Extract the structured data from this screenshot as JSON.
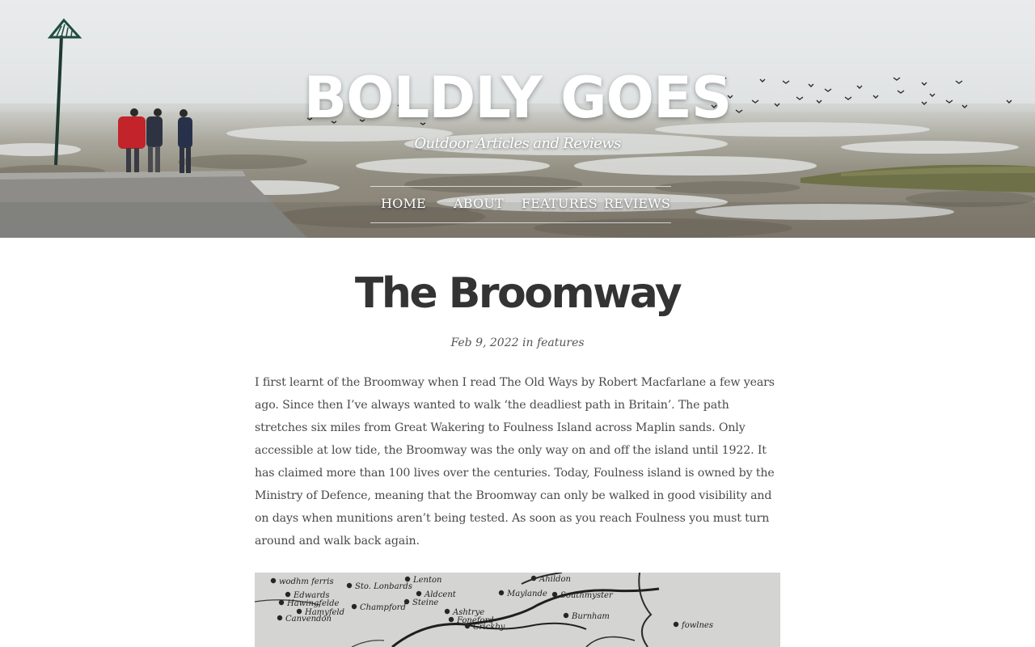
{
  "site": {
    "title": "BOLDLY GOES",
    "tagline": "Outdoor Articles and Reviews"
  },
  "nav": {
    "items": [
      {
        "label": "HOME"
      },
      {
        "label": "ABOUT"
      },
      {
        "label": "FEATURES"
      },
      {
        "label": "REVIEWS"
      }
    ]
  },
  "post": {
    "title": "The Broomway",
    "meta": {
      "date": "Feb 9, 2022",
      "in_word": "in",
      "category": "features"
    },
    "body": "I first learnt of the Broomway when I read The Old Ways by Robert Macfarlane a few years ago. Since then I’ve always wanted to walk ‘the deadliest path in Britain’. The path stretches six miles from Great Wakering to Foulness Island across Maplin sands. Only accessible at low tide, the Broomway was the only way on and off the island until 1922. It has claimed more than 100 lives over the centuries. Today, Foulness island is owned by the Ministry of Defence, meaning that the Broomway can only be walked in good visibility and on days when munitions aren’t being tested. As soon as you reach Foulness you must turn around and walk back again."
  },
  "map_image": {
    "labels": [
      "wodhm ferris",
      "Edwards",
      "Hawingfelde",
      "Hamyfeld",
      "Canvendon",
      "Sto. Lonbards",
      "Lenton",
      "Aldcent",
      "Champford",
      "Steine",
      "Foneford",
      "Ashtrye",
      "Crickby",
      "Ahildon",
      "Maylande",
      "Southmyster",
      "Burnham",
      "fowlnes"
    ]
  }
}
